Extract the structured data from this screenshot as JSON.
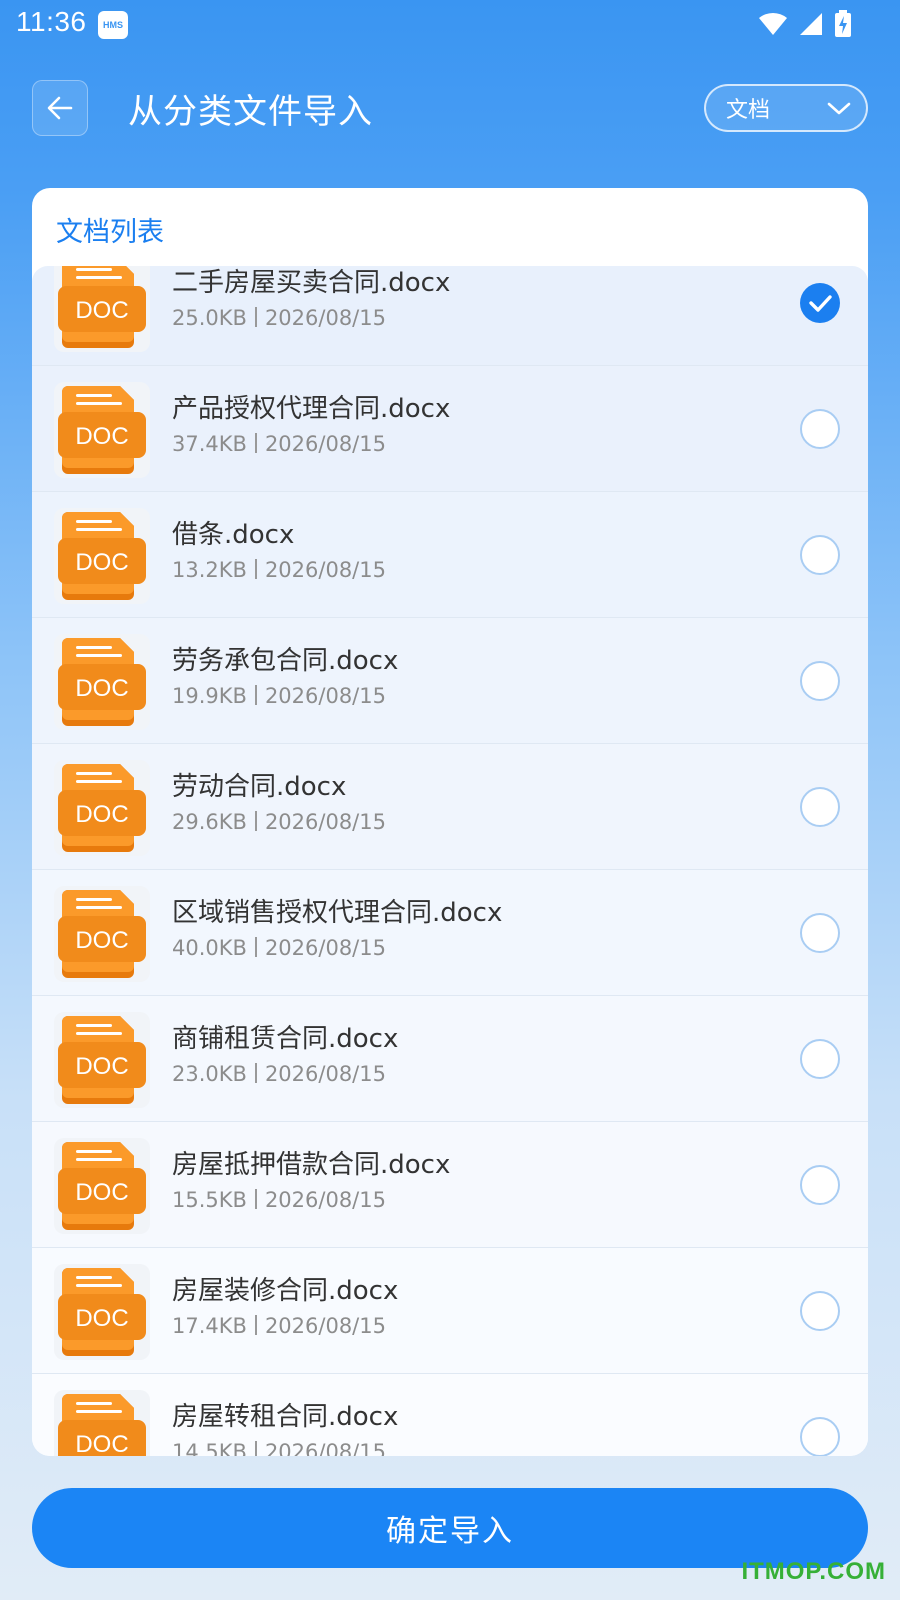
{
  "status_bar": {
    "time": "11:36",
    "hms_badge": "HMS"
  },
  "header": {
    "title": "从分类文件导入",
    "category_selected": "文档"
  },
  "card": {
    "title": "文档列表"
  },
  "doc_icon_label": "DOC",
  "files": [
    {
      "name": "二手房屋买卖合同.docx",
      "size": "25.0KB",
      "date": "2026/08/15",
      "selected": true
    },
    {
      "name": "产品授权代理合同.docx",
      "size": "37.4KB",
      "date": "2026/08/15",
      "selected": false
    },
    {
      "name": "借条.docx",
      "size": "13.2KB",
      "date": "2026/08/15",
      "selected": false
    },
    {
      "name": "劳务承包合同.docx",
      "size": "19.9KB",
      "date": "2026/08/15",
      "selected": false
    },
    {
      "name": "劳动合同.docx",
      "size": "29.6KB",
      "date": "2026/08/15",
      "selected": false
    },
    {
      "name": "区域销售授权代理合同.docx",
      "size": "40.0KB",
      "date": "2026/08/15",
      "selected": false
    },
    {
      "name": "商铺租赁合同.docx",
      "size": "23.0KB",
      "date": "2026/08/15",
      "selected": false
    },
    {
      "name": "房屋抵押借款合同.docx",
      "size": "15.5KB",
      "date": "2026/08/15",
      "selected": false
    },
    {
      "name": "房屋装修合同.docx",
      "size": "17.4KB",
      "date": "2026/08/15",
      "selected": false
    },
    {
      "name": "房屋转租合同.docx",
      "size": "14.5KB",
      "date": "2026/08/15",
      "selected": false
    }
  ],
  "confirm_button": "确定导入",
  "watermark": "ITMOP.COM",
  "colors": {
    "accent": "#1b7ff0",
    "doc_orange": "#f18b1b",
    "selected_row": "#e3eefb"
  }
}
